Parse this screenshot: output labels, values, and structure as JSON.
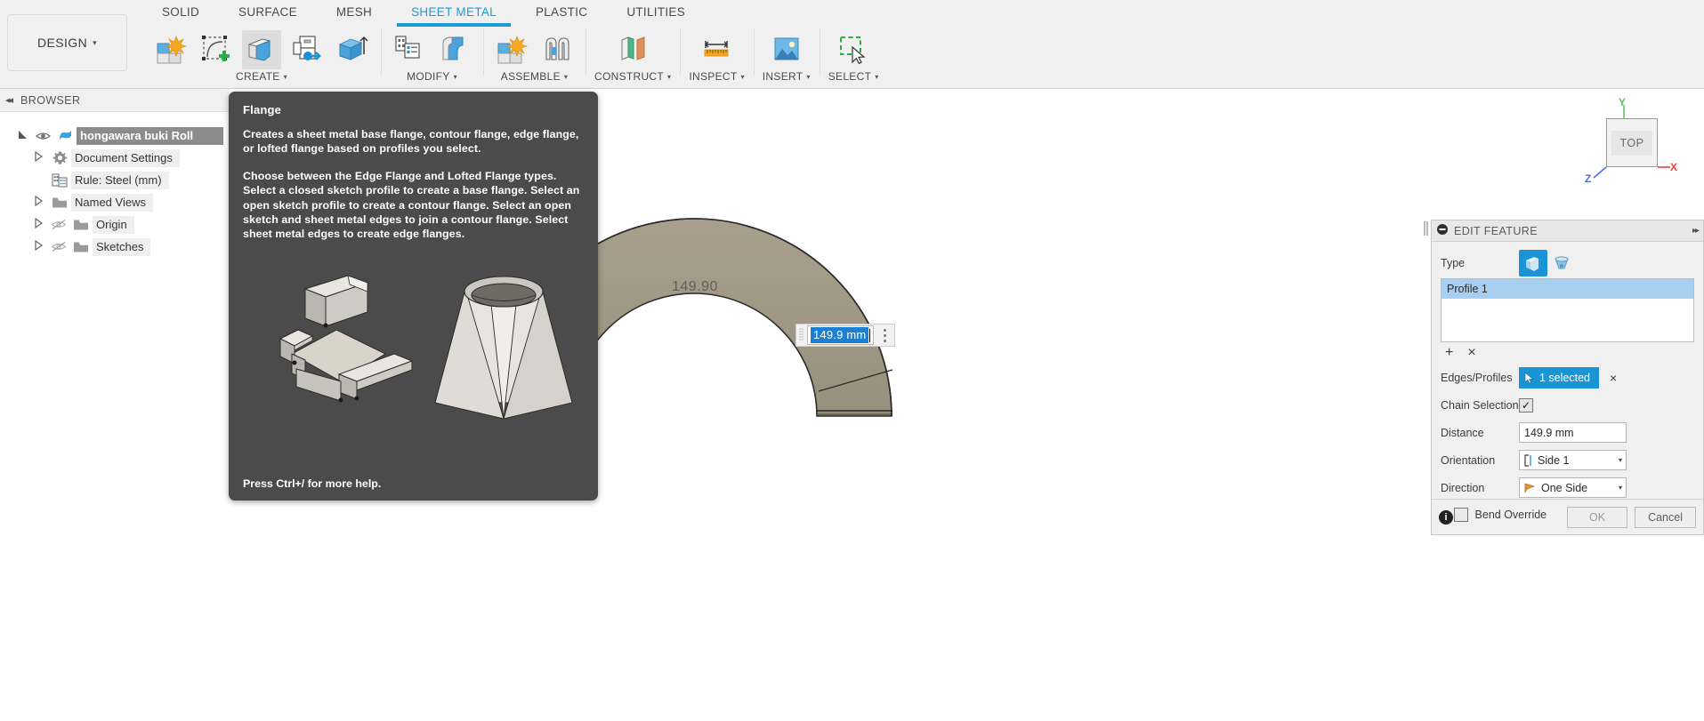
{
  "app": {
    "workspace_button": "DESIGN",
    "caret": "▾"
  },
  "ribbon": {
    "tabs": [
      {
        "label": "SOLID",
        "active": false
      },
      {
        "label": "SURFACE",
        "active": false
      },
      {
        "label": "MESH",
        "active": false
      },
      {
        "label": "SHEET METAL",
        "active": true
      },
      {
        "label": "PLASTIC",
        "active": false
      },
      {
        "label": "UTILITIES",
        "active": false
      }
    ],
    "active_tab_color": "#1a9ad6",
    "groups": [
      {
        "label": "CREATE",
        "tools": [
          {
            "name": "create-sketch-solid-icon",
            "selected": false
          },
          {
            "name": "create-sketch-icon",
            "selected": false
          },
          {
            "name": "flange-icon",
            "selected": true
          },
          {
            "name": "unfold-icon",
            "selected": false
          },
          {
            "name": "extrude-icon",
            "selected": false
          }
        ]
      },
      {
        "label": "MODIFY",
        "tools": [
          {
            "name": "bend-sheet-metal-icon",
            "selected": false
          },
          {
            "name": "convert-to-sheet-metal-icon",
            "selected": false
          }
        ]
      },
      {
        "label": "ASSEMBLE",
        "tools": [
          {
            "name": "new-component-icon",
            "selected": false
          },
          {
            "name": "joint-icon",
            "selected": false
          }
        ]
      },
      {
        "label": "CONSTRUCT",
        "tools": [
          {
            "name": "construction-plane-icon",
            "selected": false
          }
        ]
      },
      {
        "label": "INSPECT",
        "tools": [
          {
            "name": "measure-icon",
            "selected": false
          }
        ]
      },
      {
        "label": "INSERT",
        "tools": [
          {
            "name": "insert-image-icon",
            "selected": false
          }
        ]
      },
      {
        "label": "SELECT",
        "tools": [
          {
            "name": "select-window-icon",
            "selected": false
          }
        ]
      }
    ]
  },
  "browser": {
    "title": "BROWSER",
    "collapse_icon": "◂◂",
    "nodes": [
      {
        "label": "hongawara buki Roll",
        "icon": "document-icon",
        "eye": "visible",
        "arrow": "expanded",
        "level": "root"
      },
      {
        "label": "Document Settings",
        "icon": "gear-icon",
        "eye": "none",
        "arrow": "collapsed",
        "level": "child"
      },
      {
        "label": "Rule: Steel (mm)",
        "icon": "rule-icon",
        "eye": "none",
        "arrow": "none",
        "level": "child2"
      },
      {
        "label": "Named Views",
        "icon": "folder-icon",
        "eye": "none",
        "arrow": "collapsed",
        "level": "child"
      },
      {
        "label": "Origin",
        "icon": "folder-icon",
        "eye": "hidden",
        "arrow": "collapsed",
        "level": "child"
      },
      {
        "label": "Sketches",
        "icon": "folder-icon",
        "eye": "hidden",
        "arrow": "collapsed",
        "level": "child"
      }
    ]
  },
  "tooltip": {
    "title": "Flange",
    "paragraph1": "Creates a sheet metal base flange, contour flange, edge flange, or lofted flange based on profiles you select.",
    "paragraph2": "Choose between the Edge Flange and Lofted Flange types. Select a closed sketch profile to create a base flange. Select an open sketch profile to create a contour flange. Select an open sketch and sheet metal edges to join a contour flange. Select sheet metal edges to create edge flanges.",
    "footer": "Press Ctrl+/ for more help.",
    "background": "#4b4b4b"
  },
  "canvas": {
    "dimension_label": "149.90",
    "dimension_edit_value": "149.9 mm",
    "body_color": "#9e9684",
    "viewcube": {
      "face_label": "TOP",
      "axis_x": "X",
      "axis_y": "Y",
      "axis_z": "Z",
      "axis_x_color": "#e8413a",
      "axis_y_color": "#5ec46a",
      "axis_z_color": "#4d6fe0"
    }
  },
  "dialog": {
    "title": "EDIT FEATURE",
    "collapse_icon": "●",
    "expand_icon": "▸▸",
    "type_label": "Type",
    "type_options": [
      {
        "name": "edge-flange-icon",
        "active": true
      },
      {
        "name": "lofted-flange-icon",
        "active": false
      }
    ],
    "profiles": [
      {
        "label": "Profile 1",
        "selected": true
      }
    ],
    "list_add": "+",
    "list_remove": "×",
    "edges_profiles_label": "Edges/Profiles",
    "edges_profiles_value": "1 selected",
    "edges_profiles_clear": "×",
    "chain_selection_label": "Chain Selection",
    "chain_selection_checked": true,
    "chain_check_glyph": "✓",
    "distance_label": "Distance",
    "distance_value": "149.9 mm",
    "orientation_label": "Orientation",
    "orientation_value": "Side 1",
    "direction_label": "Direction",
    "direction_value": "One Side",
    "bend_override_label": "Bend Override",
    "bend_override_checked": false,
    "bend_override_expand": "▸",
    "info_glyph": "i",
    "ok_label": "OK",
    "cancel_label": "Cancel",
    "accent_color": "#1b94d6"
  }
}
